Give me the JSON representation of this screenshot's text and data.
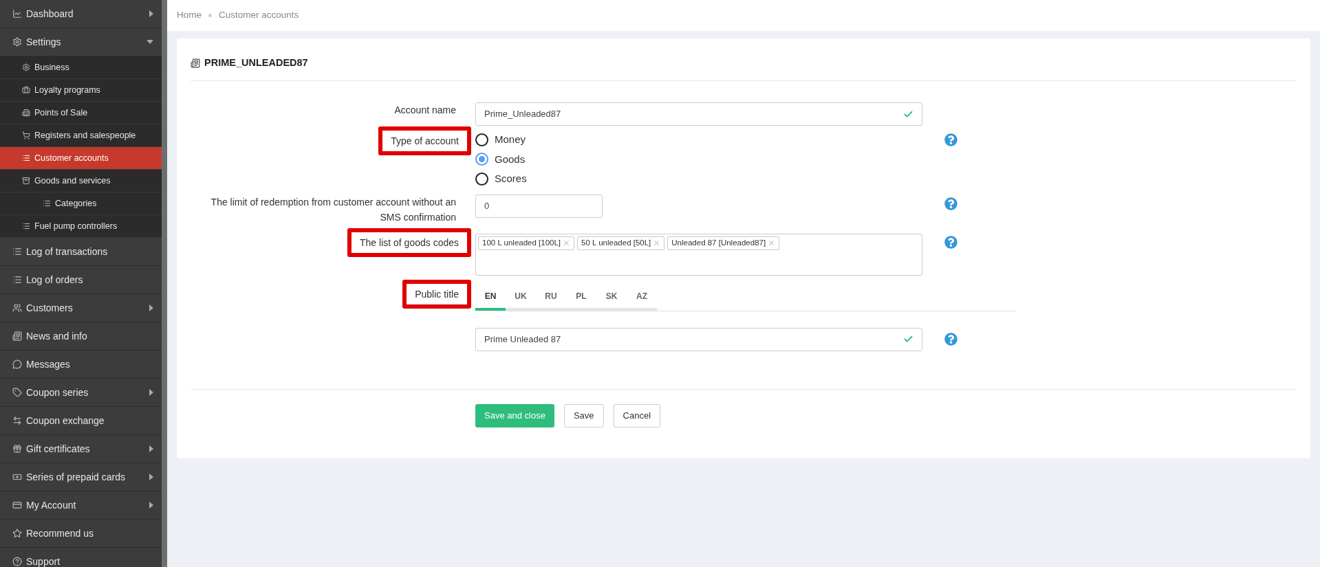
{
  "sidebar": {
    "items": [
      {
        "kind": "top",
        "label": "Dashboard",
        "selected": false,
        "expanded": false
      },
      {
        "kind": "top",
        "label": "Settings",
        "selected": false,
        "expanded": true
      },
      {
        "kind": "sub",
        "label": "Business",
        "selected": false
      },
      {
        "kind": "sub",
        "label": "Loyalty programs",
        "selected": false
      },
      {
        "kind": "sub",
        "label": "Points of Sale",
        "selected": false
      },
      {
        "kind": "sub",
        "label": "Registers and salespeople",
        "selected": false
      },
      {
        "kind": "sub",
        "label": "Customer accounts",
        "selected": true
      },
      {
        "kind": "sub",
        "label": "Goods and services",
        "selected": false
      },
      {
        "kind": "subsub",
        "label": "Categories",
        "selected": false
      },
      {
        "kind": "sub",
        "label": "Fuel pump controllers",
        "selected": false
      },
      {
        "kind": "top",
        "label": "Log of transactions",
        "selected": false
      },
      {
        "kind": "top",
        "label": "Log of orders",
        "selected": false
      },
      {
        "kind": "top",
        "label": "Customers",
        "selected": false,
        "expanded": false
      },
      {
        "kind": "top",
        "label": "News and info",
        "selected": false
      },
      {
        "kind": "top",
        "label": "Messages",
        "selected": false
      },
      {
        "kind": "top",
        "label": "Coupon series",
        "selected": false,
        "expanded": false
      },
      {
        "kind": "top",
        "label": "Coupon exchange",
        "selected": false
      },
      {
        "kind": "top",
        "label": "Gift certificates",
        "selected": false,
        "expanded": false
      },
      {
        "kind": "top",
        "label": "Series of prepaid cards",
        "selected": false,
        "expanded": false
      },
      {
        "kind": "top",
        "label": "My Account",
        "selected": false,
        "expanded": false
      },
      {
        "kind": "top",
        "label": "Recommend us",
        "selected": false
      },
      {
        "kind": "top",
        "label": "Support",
        "selected": false
      }
    ]
  },
  "breadcrumb": [
    "Home",
    "Customer accounts"
  ],
  "card": {
    "title": "PRIME_UNLEADED87",
    "account_name": {
      "label": "Account name",
      "value": "Prime_Unleaded87",
      "valid": true,
      "highlighted": false
    },
    "account_type": {
      "label": "Type of account",
      "highlighted": true,
      "options": [
        {
          "label": "Money",
          "selected": false
        },
        {
          "label": "Goods",
          "selected": true
        },
        {
          "label": "Scores",
          "selected": false
        }
      ]
    },
    "limit": {
      "label": "The limit of redemption from customer account without an SMS confirmation",
      "value": "0",
      "highlighted": false
    },
    "goods_codes": {
      "label": "The list of goods codes",
      "highlighted": true,
      "tags": [
        "100 L unleaded [100L]",
        "50 L unleaded [50L]",
        "Unleaded 87 [Unleaded87]"
      ]
    },
    "public_title": {
      "label": "Public title",
      "highlighted": true,
      "tabs": [
        {
          "label": "EN",
          "selected": true
        },
        {
          "label": "UK",
          "selected": false
        },
        {
          "label": "RU",
          "selected": false
        },
        {
          "label": "PL",
          "selected": false
        },
        {
          "label": "SK",
          "selected": false
        },
        {
          "label": "AZ",
          "selected": false
        }
      ],
      "value": "Prime Unleaded 87",
      "valid": true
    },
    "buttons": [
      {
        "label": "Save and close",
        "kind": "primary"
      },
      {
        "label": "Save",
        "kind": "default"
      },
      {
        "label": "Cancel",
        "kind": "default"
      }
    ]
  }
}
